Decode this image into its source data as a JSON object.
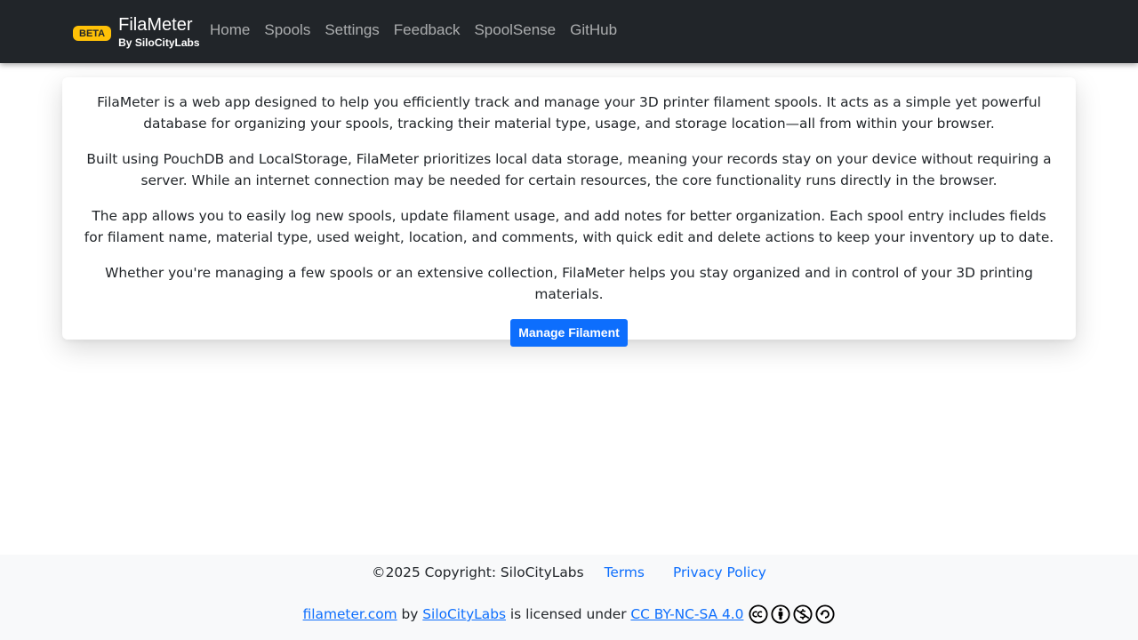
{
  "navbar": {
    "badge": "BETA",
    "brand_title": "FilaMeter",
    "brand_subtitle": "By SiloCityLabs",
    "links": [
      "Home",
      "Spools",
      "Settings",
      "Feedback",
      "SpoolSense",
      "GitHub"
    ]
  },
  "intro": {
    "paragraphs": [
      "FilaMeter is a web app designed to help you efficiently track and manage your 3D printer filament spools. It acts as a simple yet powerful database for organizing your spools, tracking their material type, usage, and storage location—all from within your browser.",
      "Built using PouchDB and LocalStorage, FilaMeter prioritizes local data storage, meaning your records stay on your device without requiring a server. While an internet connection may be needed for certain resources, the core functionality runs directly in the browser.",
      "The app allows you to easily log new spools, update filament usage, and add notes for better organization. Each spool entry includes fields for filament name, material type, used weight, location, and comments, with quick edit and delete actions to keep your inventory up to date.",
      "Whether you're managing a few spools or an extensive collection, FilaMeter helps you stay organized and in control of your 3D printing materials."
    ],
    "cta_label": "Manage Filament"
  },
  "footer": {
    "copyright": "©2025 Copyright: SiloCityLabs",
    "terms": "Terms",
    "privacy": "Privacy Policy",
    "license_site": "filameter.com",
    "license_by": " by ",
    "license_author": "SiloCityLabs",
    "license_mid": " is licensed under ",
    "license_name": "CC BY-NC-SA 4.0",
    "license_icons": [
      "cc-icon",
      "by-icon",
      "nc-icon",
      "sa-icon"
    ]
  },
  "colors": {
    "navbar_bg": "#212529",
    "badge": "#ffc107",
    "primary": "#0d6efd",
    "footer_bg": "#f8f9fa"
  }
}
